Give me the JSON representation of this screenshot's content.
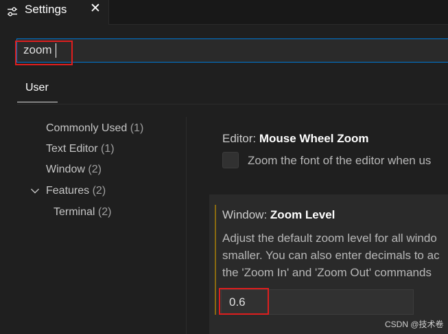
{
  "tab": {
    "title": "Settings",
    "icon": "settings-sliders-icon",
    "close_glyph": "✕"
  },
  "search": {
    "value": "zoom"
  },
  "scope": {
    "user_label": "User"
  },
  "toc": {
    "items": [
      {
        "label": "Commonly Used",
        "count": "(1)"
      },
      {
        "label": "Text Editor",
        "count": "(1)"
      },
      {
        "label": "Window",
        "count": "(2)"
      },
      {
        "label": "Features",
        "count": "(2)",
        "expanded": true
      },
      {
        "label": "Terminal",
        "count": "(2)"
      }
    ]
  },
  "settings": [
    {
      "category": "Editor: ",
      "name": "Mouse Wheel Zoom",
      "description": "Zoom the font of the editor when us"
    },
    {
      "category": "Window: ",
      "name": "Zoom Level",
      "description_lines": [
        "Adjust the default zoom level for all windo",
        "smaller. You can also enter decimals to ac",
        "the 'Zoom In' and 'Zoom Out' commands"
      ],
      "value": "0.6"
    }
  ],
  "watermark": "CSDN @技术卷",
  "colors": {
    "focus_border": "#0078d4",
    "annotation_box": "#e01e1e",
    "modified_indicator": "#8a6a10"
  }
}
